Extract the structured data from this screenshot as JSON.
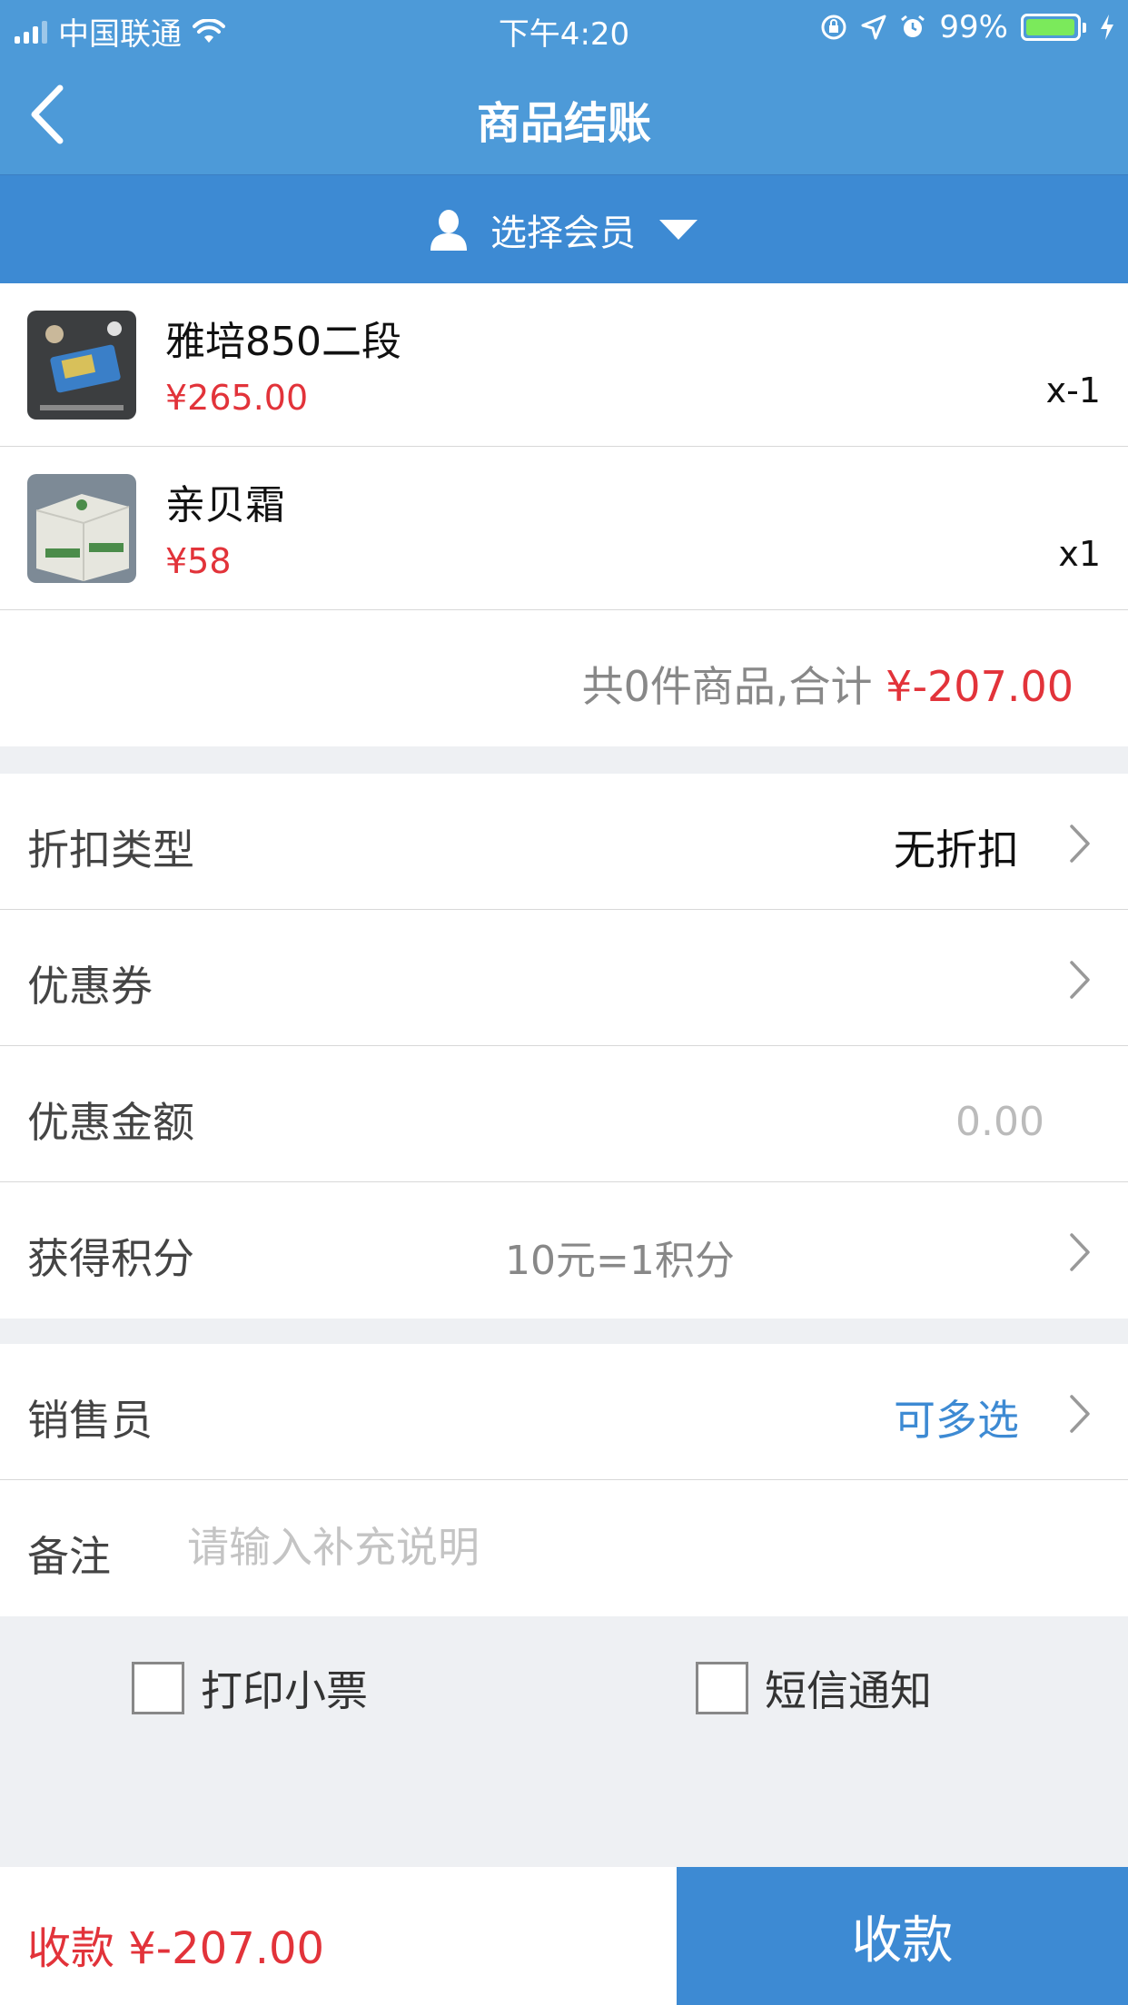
{
  "status_bar": {
    "carrier": "中国联通",
    "time": "下午4:20",
    "battery_percent": "99%",
    "battery_level": 0.99,
    "icons": [
      "signal-icon",
      "wifi-icon",
      "rotation-lock-icon",
      "location-icon",
      "alarm-icon",
      "battery-icon",
      "charging-icon"
    ]
  },
  "nav": {
    "title": "商品结账",
    "back_icon": "chevron-left-icon"
  },
  "member": {
    "label": "选择会员",
    "icon": "user-icon",
    "dropdown_icon": "caret-down-icon"
  },
  "products": [
    {
      "name": "雅培850二段",
      "price": "¥265.00",
      "qty": "x-1"
    },
    {
      "name": "亲贝霜",
      "price": "¥58",
      "qty": "x1"
    }
  ],
  "totals": {
    "summary_prefix": "共0件商品,合计",
    "amount": "¥-207.00"
  },
  "settings": {
    "discount_type_label": "折扣类型",
    "discount_type_value": "无折扣",
    "coupon_label": "优惠券",
    "discount_amount_label": "优惠金额",
    "discount_amount_value": "0.00",
    "points_label": "获得积分",
    "points_rule": "10元=1积分"
  },
  "staff": {
    "salesperson_label": "销售员",
    "salesperson_value": "可多选",
    "remark_label": "备注",
    "remark_placeholder": "请输入补充说明"
  },
  "options": {
    "print_receipt_label": "打印小票",
    "print_receipt_checked": false,
    "sms_notify_label": "短信通知",
    "sms_notify_checked": false
  },
  "footer": {
    "due_label": "收款 ¥-207.00",
    "pay_button": "收款"
  },
  "colors": {
    "header_blue": "#4d9ad8",
    "accent_blue": "#3d8ad3",
    "price_red": "#e2333a"
  }
}
